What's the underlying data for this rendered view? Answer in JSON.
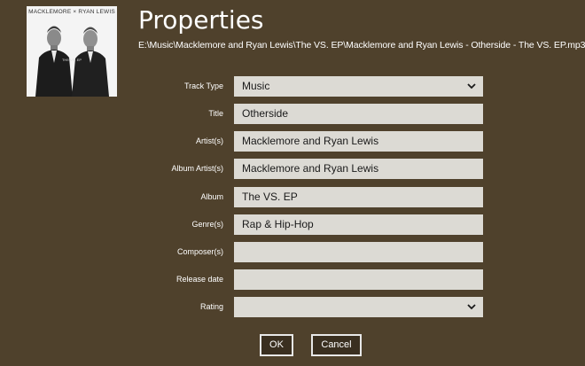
{
  "window": {
    "title": "Properties",
    "file_path": "E:\\Music\\Macklemore and Ryan Lewis\\The VS. EP\\Macklemore and Ryan Lewis - Otherside - The VS. EP.mp3"
  },
  "album_art": {
    "caption": "MACKLEMORE × RYAN LEWIS",
    "subcaption": "THE VS. EP"
  },
  "fields": {
    "track_type": {
      "label": "Track Type",
      "value": "Music",
      "icon": "chevron-down-icon"
    },
    "title": {
      "label": "Title",
      "value": "Otherside"
    },
    "artists": {
      "label": "Artist(s)",
      "value": "Macklemore and Ryan Lewis"
    },
    "album_artists": {
      "label": "Album Artist(s)",
      "value": "Macklemore and Ryan Lewis"
    },
    "album": {
      "label": "Album",
      "value": "The VS. EP"
    },
    "genres": {
      "label": "Genre(s)",
      "value": "Rap & Hip-Hop"
    },
    "composers": {
      "label": "Composer(s)",
      "value": ""
    },
    "release_date": {
      "label": "Release date",
      "value": ""
    },
    "rating": {
      "label": "Rating",
      "value": "",
      "icon": "chevron-down-icon"
    }
  },
  "buttons": {
    "ok_label": "OK",
    "cancel_label": "Cancel"
  },
  "colors": {
    "background": "#4f412c",
    "field_background": "#dcdad4",
    "button_background": "#3a2f20",
    "button_border": "#e8e8e8"
  }
}
